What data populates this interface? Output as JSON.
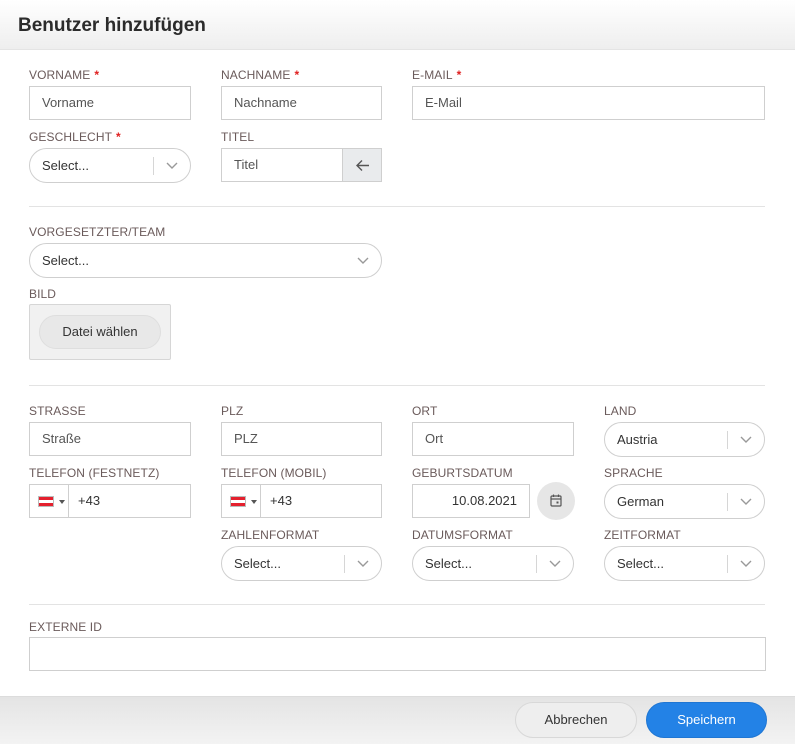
{
  "header": {
    "title": "Benutzer hinzufügen"
  },
  "fields": {
    "vorname": {
      "label": "VORNAME",
      "placeholder": "Vorname",
      "required": "*"
    },
    "nachname": {
      "label": "NACHNAME",
      "placeholder": "Nachname",
      "required": "*"
    },
    "email": {
      "label": "E-MAIL",
      "placeholder": "E-Mail",
      "required": "*"
    },
    "geschlecht": {
      "label": "GESCHLECHT",
      "value": "Select...",
      "required": "*"
    },
    "titel": {
      "label": "TITEL",
      "placeholder": "Titel"
    },
    "vorgesetzter": {
      "label": "VORGESETZTER/TEAM",
      "value": "Select..."
    },
    "bild": {
      "label": "BILD",
      "button": "Datei wählen"
    },
    "strasse": {
      "label": "STRASSE",
      "placeholder": "Straße"
    },
    "plz": {
      "label": "PLZ",
      "placeholder": "PLZ"
    },
    "ort": {
      "label": "ORT",
      "placeholder": "Ort"
    },
    "land": {
      "label": "LAND",
      "value": "Austria"
    },
    "telefon_festnetz": {
      "label": "TELEFON (FESTNETZ)",
      "value": "+43"
    },
    "telefon_mobil": {
      "label": "TELEFON (MOBIL)",
      "value": "+43"
    },
    "geburtsdatum": {
      "label": "GEBURTSDATUM",
      "value": "10.08.2021"
    },
    "sprache": {
      "label": "SPRACHE",
      "value": "German"
    },
    "zahlenformat": {
      "label": "ZAHLENFORMAT",
      "value": "Select..."
    },
    "datumsformat": {
      "label": "DATUMSFORMAT",
      "value": "Select..."
    },
    "zeitformat": {
      "label": "ZEITFORMAT",
      "value": "Select..."
    },
    "externe_id": {
      "label": "EXTERNE ID",
      "value": ""
    }
  },
  "footer": {
    "cancel_label": "Abbrechen",
    "save_label": "Speichern"
  },
  "colors": {
    "accent": "#2382e6",
    "required": "#e02020"
  },
  "icons": {
    "title_button": "arrow-left-icon",
    "calendar": "calendar-icon",
    "dropdown": "chevron-down-icon",
    "flag": "austria-flag-icon"
  }
}
